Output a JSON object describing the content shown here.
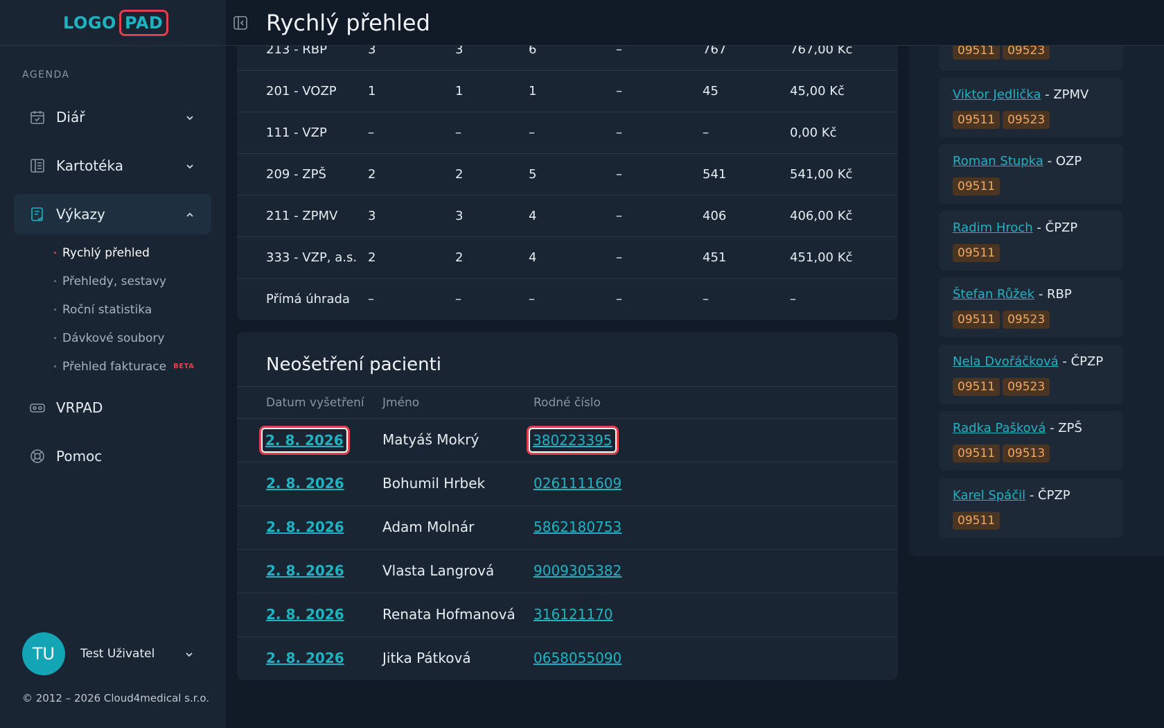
{
  "logo": {
    "part1": "LOGO",
    "part2": "PAD"
  },
  "sidebar": {
    "section": "AGENDA",
    "items": [
      {
        "label": "Diář"
      },
      {
        "label": "Kartotéka"
      },
      {
        "label": "Výkazy"
      },
      {
        "label": "VRPAD"
      },
      {
        "label": "Pomoc"
      }
    ],
    "subitems": [
      {
        "label": "Rychlý přehled"
      },
      {
        "label": "Přehledy, sestavy"
      },
      {
        "label": "Roční statistika"
      },
      {
        "label": "Dávkové soubory"
      },
      {
        "label": "Přehled fakturace"
      }
    ],
    "beta": "BETA"
  },
  "user": {
    "initials": "TU",
    "name": "Test Uživatel"
  },
  "copyright": "© 2012 – 2026 Cloud4medical s.r.o.",
  "header": {
    "title": "Rychlý přehled"
  },
  "insurance_table": {
    "rows": [
      {
        "name": "213 - RBP",
        "c1": "3",
        "c2": "3",
        "c3": "6",
        "c4": "–",
        "c5": "767",
        "c6": "767,00 Kč"
      },
      {
        "name": "201 - VOZP",
        "c1": "1",
        "c2": "1",
        "c3": "1",
        "c4": "–",
        "c5": "45",
        "c6": "45,00 Kč"
      },
      {
        "name": "111 - VZP",
        "c1": "–",
        "c2": "–",
        "c3": "–",
        "c4": "–",
        "c5": "–",
        "c6": "0,00 Kč"
      },
      {
        "name": "209 - ZPŠ",
        "c1": "2",
        "c2": "2",
        "c3": "5",
        "c4": "–",
        "c5": "541",
        "c6": "541,00 Kč"
      },
      {
        "name": "211 - ZPMV",
        "c1": "3",
        "c2": "3",
        "c3": "4",
        "c4": "–",
        "c5": "406",
        "c6": "406,00 Kč"
      },
      {
        "name": "333 - VZP, a.s.",
        "c1": "2",
        "c2": "2",
        "c3": "4",
        "c4": "–",
        "c5": "451",
        "c6": "451,00 Kč"
      },
      {
        "name": "Přímá úhrada",
        "c1": "–",
        "c2": "–",
        "c3": "–",
        "c4": "–",
        "c5": "–",
        "c6": "–"
      }
    ]
  },
  "untreated": {
    "title": "Neošetření pacienti",
    "headers": {
      "date": "Datum vyšetření",
      "name": "Jméno",
      "rc": "Rodné číslo"
    },
    "rows": [
      {
        "date": "2. 8. 2026",
        "name": "Matyáš Mokrý",
        "rc": "380223395"
      },
      {
        "date": "2. 8. 2026",
        "name": "Bohumil Hrbek",
        "rc": "0261111609"
      },
      {
        "date": "2. 8. 2026",
        "name": "Adam Molnár",
        "rc": "5862180753"
      },
      {
        "date": "2. 8. 2026",
        "name": "Vlasta Langrová",
        "rc": "9009305382"
      },
      {
        "date": "2. 8. 2026",
        "name": "Renata Hofmanová",
        "rc": "316121170"
      },
      {
        "date": "2. 8. 2026",
        "name": "Jitka Pátková",
        "rc": "0658055090"
      }
    ]
  },
  "right_panel": {
    "cards": [
      {
        "name": "",
        "ins": "",
        "tags": [
          "09511",
          "09523"
        ]
      },
      {
        "name": "Viktor Jedlička",
        "ins": " - ZPMV",
        "tags": [
          "09511",
          "09523"
        ]
      },
      {
        "name": "Roman Stupka",
        "ins": " - OZP",
        "tags": [
          "09511"
        ]
      },
      {
        "name": "Radim Hroch",
        "ins": " - ČPZP",
        "tags": [
          "09511"
        ]
      },
      {
        "name": "Štefan Růžek",
        "ins": " - RBP",
        "tags": [
          "09511",
          "09523"
        ]
      },
      {
        "name": "Nela Dvořáčková",
        "ins": " - ČPZP",
        "tags": [
          "09511",
          "09523"
        ]
      },
      {
        "name": "Radka Pašková",
        "ins": " - ZPŠ",
        "tags": [
          "09511",
          "09513"
        ]
      },
      {
        "name": "Karel Spáčil",
        "ins": " - ČPZP",
        "tags": [
          "09511"
        ]
      }
    ]
  },
  "colors": {
    "accent": "#1fb3c2",
    "highlight": "#e0404b",
    "tag_bg": "#4a3422",
    "tag_fg": "#f0a865"
  }
}
